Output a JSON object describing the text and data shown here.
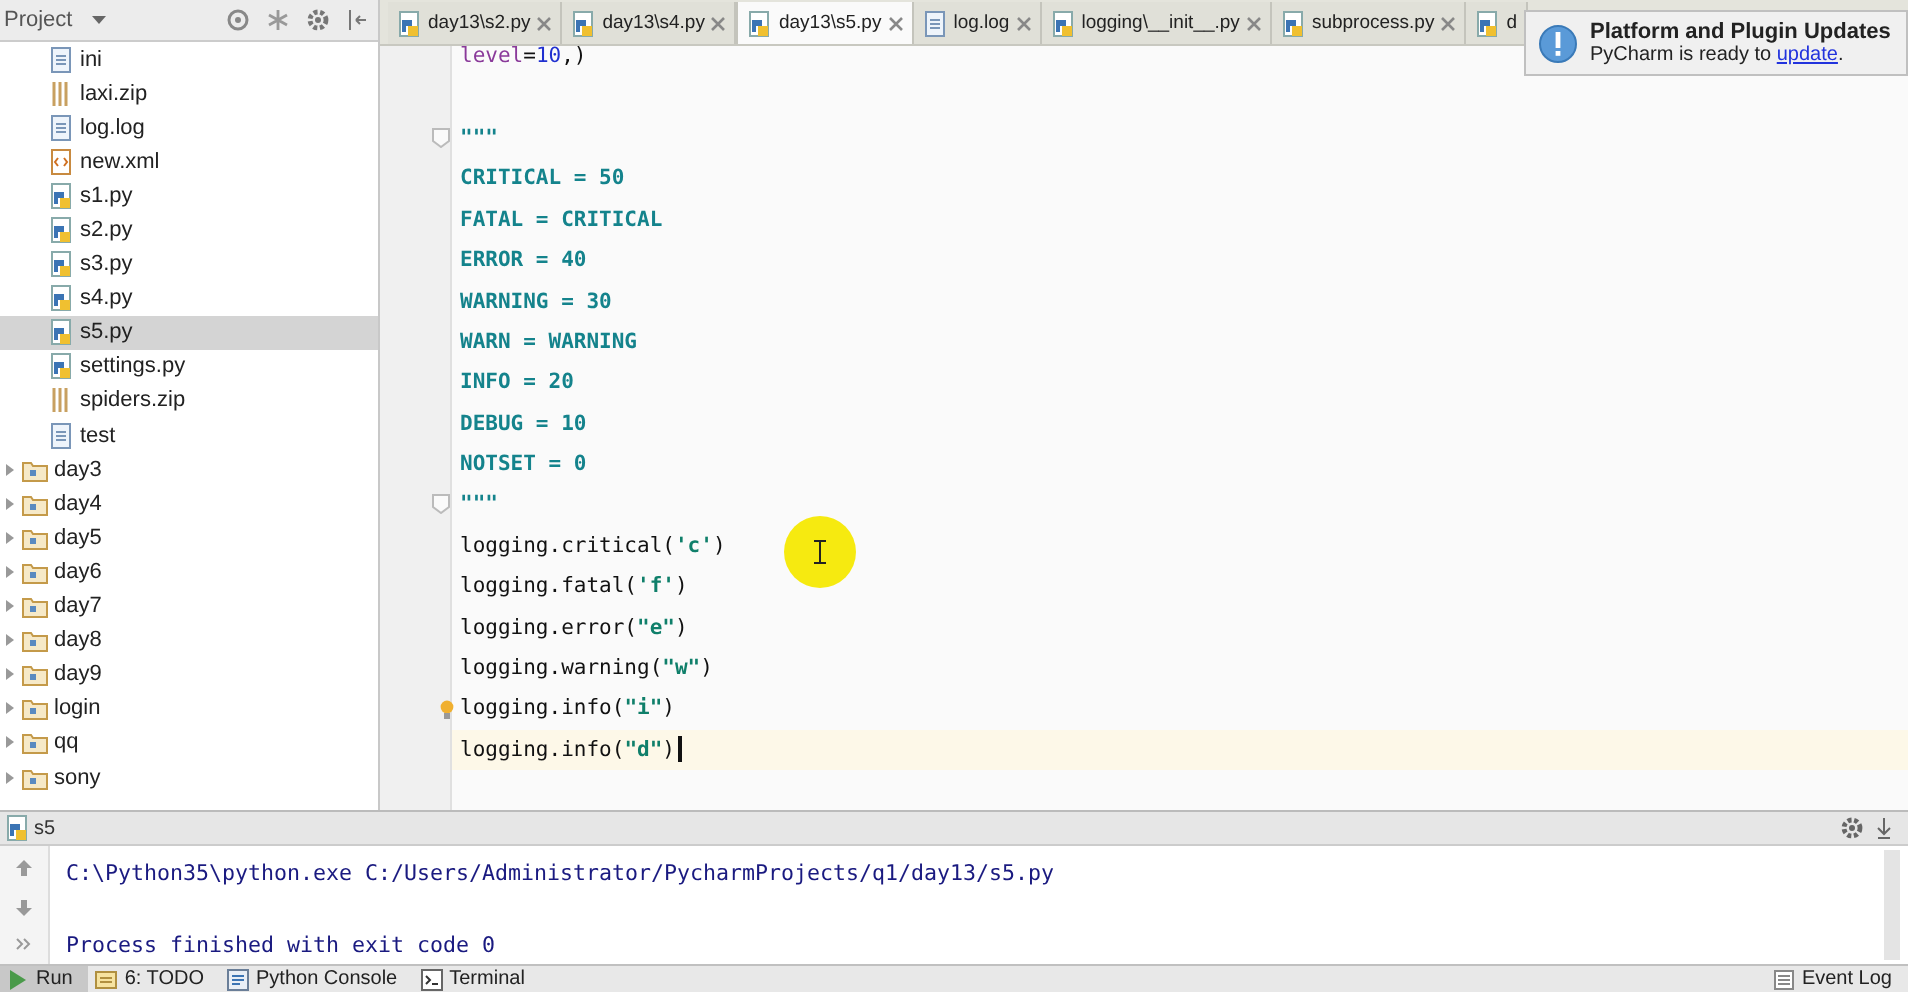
{
  "project_panel": {
    "title": "Project",
    "files": [
      {
        "name": "ini",
        "kind": "text",
        "selected": false
      },
      {
        "name": "laxi.zip",
        "kind": "zip",
        "selected": false
      },
      {
        "name": "log.log",
        "kind": "text",
        "selected": false
      },
      {
        "name": "new.xml",
        "kind": "xml",
        "selected": false
      },
      {
        "name": "s1.py",
        "kind": "python",
        "selected": false
      },
      {
        "name": "s2.py",
        "kind": "python",
        "selected": false
      },
      {
        "name": "s3.py",
        "kind": "python",
        "selected": false
      },
      {
        "name": "s4.py",
        "kind": "python",
        "selected": false
      },
      {
        "name": "s5.py",
        "kind": "python",
        "selected": true
      },
      {
        "name": "settings.py",
        "kind": "python",
        "selected": false
      },
      {
        "name": "spiders.zip",
        "kind": "zip",
        "selected": false
      },
      {
        "name": "test",
        "kind": "text",
        "selected": false
      }
    ],
    "folders": [
      {
        "name": "day3",
        "expanded": false
      },
      {
        "name": "day4",
        "expanded": false
      },
      {
        "name": "day5",
        "expanded": false
      },
      {
        "name": "day6",
        "expanded": false
      },
      {
        "name": "day7",
        "expanded": false
      },
      {
        "name": "day8",
        "expanded": false
      },
      {
        "name": "day9",
        "expanded": false
      },
      {
        "name": "login",
        "expanded": false
      },
      {
        "name": "qq",
        "expanded": false
      },
      {
        "name": "sony",
        "expanded": false
      }
    ]
  },
  "tabs": [
    {
      "label": "day13\\s2.py",
      "kind": "python",
      "selected": false,
      "close_button": true
    },
    {
      "label": "day13\\s4.py",
      "kind": "python",
      "selected": false,
      "close_button": true
    },
    {
      "label": "day13\\s5.py",
      "kind": "python",
      "selected": true,
      "close_button": true
    },
    {
      "label": "log.log",
      "kind": "text",
      "selected": false,
      "close_button": true
    },
    {
      "label": "logging\\__init__.py",
      "kind": "python",
      "selected": false,
      "close_button": true
    },
    {
      "label": "subprocess.py",
      "kind": "python",
      "selected": false,
      "close_button": true
    },
    {
      "label": "d",
      "kind": "python",
      "selected": false,
      "close_button": false
    }
  ],
  "editor": {
    "lines": [
      {
        "kind": "code",
        "current": false,
        "segments": [
          {
            "t": "level",
            "kind": "param"
          },
          {
            "t": "=",
            "kind": "plain"
          },
          {
            "t": "10",
            "kind": "number"
          },
          {
            "t": ",)",
            "kind": "plain"
          }
        ]
      },
      {
        "kind": "blank",
        "current": false
      },
      {
        "kind": "docstring",
        "current": false,
        "fold": true,
        "text": "\"\"\""
      },
      {
        "kind": "docstring",
        "current": false,
        "text": "CRITICAL = 50"
      },
      {
        "kind": "docstring",
        "current": false,
        "text": "FATAL = CRITICAL"
      },
      {
        "kind": "docstring",
        "current": false,
        "text": "ERROR = 40"
      },
      {
        "kind": "docstring",
        "current": false,
        "text": "WARNING = 30"
      },
      {
        "kind": "docstring",
        "current": false,
        "text": "WARN = WARNING"
      },
      {
        "kind": "docstring",
        "current": false,
        "text": "INFO = 20"
      },
      {
        "kind": "docstring",
        "current": false,
        "text": "DEBUG = 10"
      },
      {
        "kind": "docstring",
        "current": false,
        "text": "NOTSET = 0"
      },
      {
        "kind": "docstring",
        "current": false,
        "fold": true,
        "text": "\"\"\""
      },
      {
        "kind": "code",
        "current": false,
        "segments": [
          {
            "t": "logging.critical(",
            "kind": "plain"
          },
          {
            "t": "'c'",
            "kind": "string"
          },
          {
            "t": ")",
            "kind": "plain"
          }
        ]
      },
      {
        "kind": "code",
        "current": false,
        "segments": [
          {
            "t": "logging.fatal(",
            "kind": "plain"
          },
          {
            "t": "'f'",
            "kind": "string"
          },
          {
            "t": ")",
            "kind": "plain"
          }
        ]
      },
      {
        "kind": "code",
        "current": false,
        "segments": [
          {
            "t": "logging.error(",
            "kind": "plain"
          },
          {
            "t": "\"e\"",
            "kind": "string"
          },
          {
            "t": ")",
            "kind": "plain"
          }
        ]
      },
      {
        "kind": "code",
        "current": false,
        "segments": [
          {
            "t": "logging.warning(",
            "kind": "plain"
          },
          {
            "t": "\"w\"",
            "kind": "string"
          },
          {
            "t": ")",
            "kind": "plain"
          }
        ]
      },
      {
        "kind": "code",
        "current": false,
        "bulb": true,
        "segments": [
          {
            "t": "logging.info(",
            "kind": "plain"
          },
          {
            "t": "\"i\"",
            "kind": "string"
          },
          {
            "t": ")",
            "kind": "plain"
          }
        ]
      },
      {
        "kind": "code",
        "current": true,
        "segments": [
          {
            "t": "logging.info(",
            "kind": "plain"
          },
          {
            "t": "\"d\"",
            "kind": "string"
          },
          {
            "t": ")",
            "kind": "plain"
          }
        ]
      }
    ]
  },
  "notification": {
    "title": "Platform and Plugin Updates",
    "message": "PyCharm is ready to ",
    "link": "update",
    "message_end": "."
  },
  "run_panel": {
    "tab": "s5",
    "output": [
      {
        "kind": "text",
        "text": "C:\\Python35\\python.exe C:/Users/Administrator/PycharmProjects/q1/day13/s5.py"
      },
      {
        "kind": "blank"
      },
      {
        "kind": "text",
        "text": "Process finished with exit code 0"
      }
    ]
  },
  "tool_bar": {
    "left": [
      {
        "label": "Run",
        "kind": "run",
        "selected": true
      },
      {
        "label": "6: TODO",
        "kind": "todo",
        "selected": false
      },
      {
        "label": "Python Console",
        "kind": "console",
        "selected": false
      },
      {
        "label": "Terminal",
        "kind": "terminal",
        "selected": false
      }
    ],
    "right": [
      {
        "label": "Event Log",
        "kind": "log",
        "selected": false
      }
    ]
  }
}
